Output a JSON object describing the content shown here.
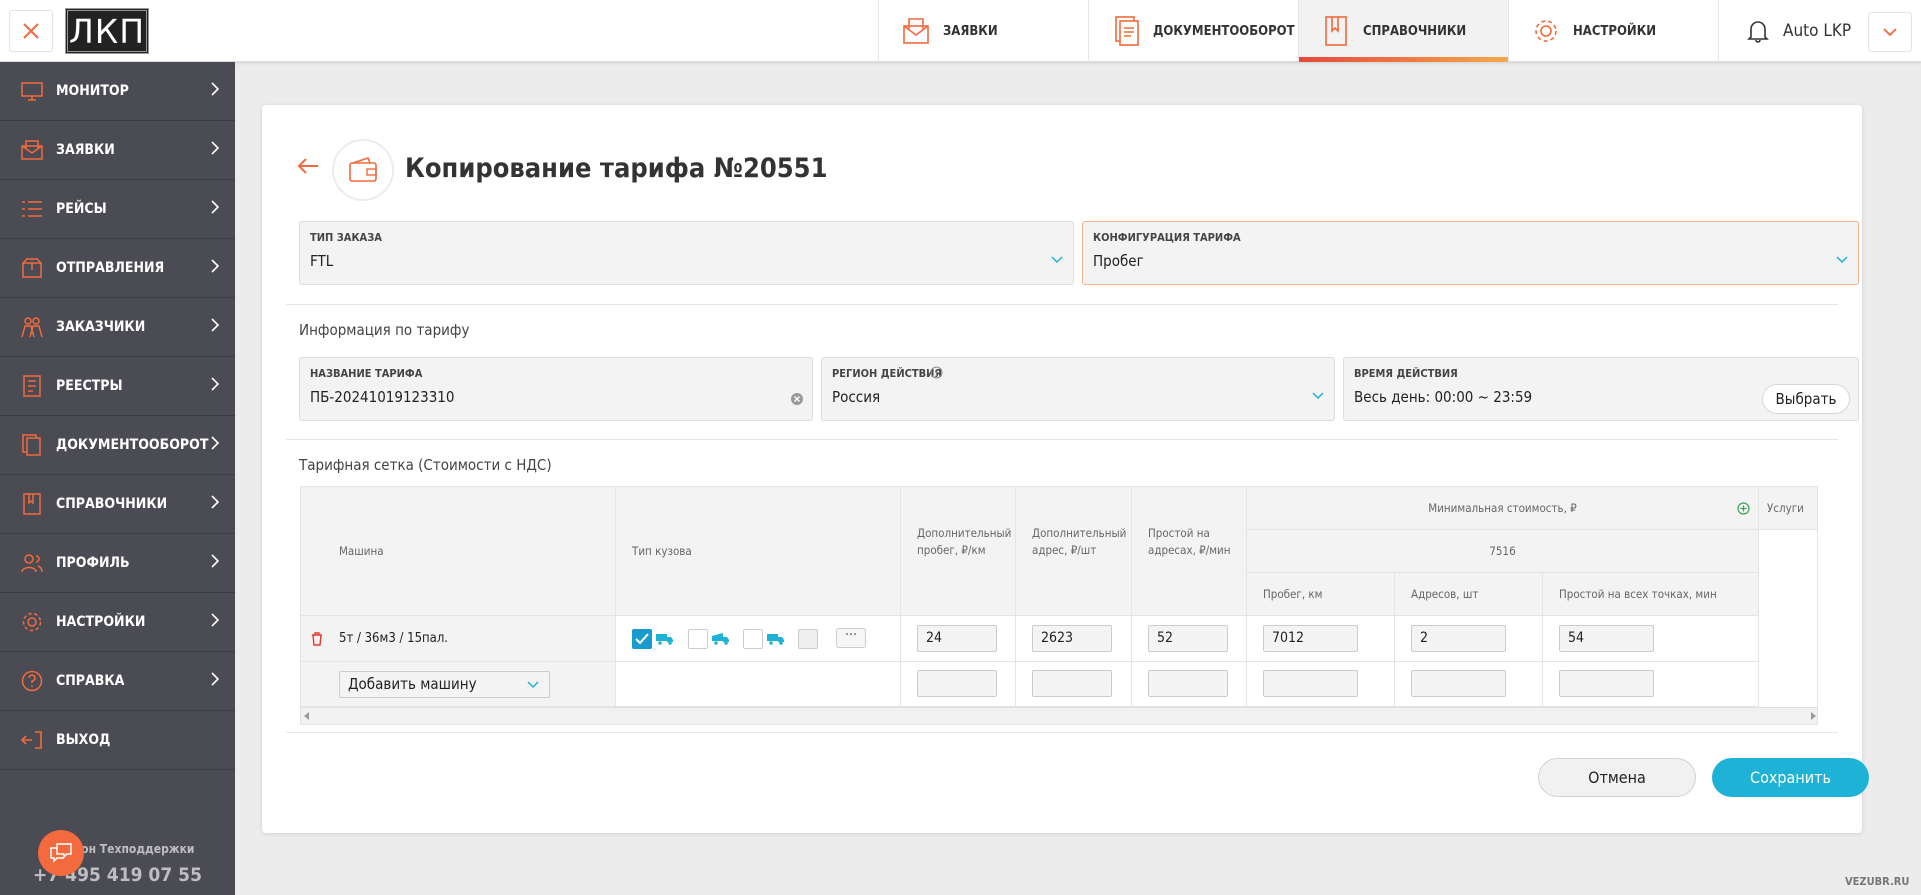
{
  "header": {
    "logo": "ЛКП",
    "tabs": [
      {
        "label": "ЗАЯВКИ",
        "icon": "envelope-icon"
      },
      {
        "label": "ДОКУМЕНТООБОРОТ",
        "icon": "documents-icon"
      },
      {
        "label": "СПРАВОЧНИКИ",
        "icon": "bookmark-book-icon",
        "active": true
      },
      {
        "label": "НАСТРОЙКИ",
        "icon": "gear-icon"
      }
    ],
    "user": "Auto LKP"
  },
  "sidebar": {
    "items": [
      {
        "label": "МОНИТОР",
        "icon": "monitor-icon"
      },
      {
        "label": "ЗАЯВКИ",
        "icon": "envelope-icon"
      },
      {
        "label": "РЕЙСЫ",
        "icon": "list-icon"
      },
      {
        "label": "ОТПРАВЛЕНИЯ",
        "icon": "box-icon"
      },
      {
        "label": "ЗАКАЗЧИКИ",
        "icon": "customers-icon"
      },
      {
        "label": "РЕЕСТРЫ",
        "icon": "registry-icon"
      },
      {
        "label": "ДОКУМЕНТООБОРОТ",
        "icon": "documents-icon"
      },
      {
        "label": "СПРАВОЧНИКИ",
        "icon": "book-icon"
      },
      {
        "label": "ПРОФИЛЬ",
        "icon": "profile-icon"
      },
      {
        "label": "НАСТРОЙКИ",
        "icon": "gear-icon"
      },
      {
        "label": "СПРАВКА",
        "icon": "help-icon"
      },
      {
        "label": "ВЫХОД",
        "icon": "logout-icon"
      }
    ],
    "support_label": "Телефон Техподдержки",
    "support_phone": "+7 495 419 07 55"
  },
  "page": {
    "title": "Копирование тарифа №20551",
    "order_type": {
      "label": "ТИП ЗАКАЗА",
      "value": "FTL"
    },
    "tariff_config": {
      "label": "КОНФИГУРАЦИЯ ТАРИФА",
      "value": "Пробег"
    },
    "info_section": "Информация по тарифу",
    "tariff_name": {
      "label": "НАЗВАНИЕ ТАРИФА",
      "value": "ПБ-20241019123310"
    },
    "region": {
      "label": "РЕГИОН ДЕЙСТВИЯ",
      "value": "Россия"
    },
    "time": {
      "label": "ВРЕМЯ ДЕЙСТВИЯ",
      "value": "Весь день: 00:00 ~ 23:59",
      "button": "Выбрать"
    },
    "grid_section": "Тарифная сетка (Стоимости с НДС)"
  },
  "grid": {
    "headers": {
      "car": "Машина",
      "body": "Тип кузова",
      "extra_km": "Дополнительный пробег, ₽/км",
      "extra_addr": "Дополнительный адрес, ₽/шт",
      "idle": "Простой на адресах, ₽/мин",
      "min_cost": "Минимальная стоимость, ₽",
      "min_cost_value": "7516",
      "services": "Услуги",
      "mileage": "Пробег, км",
      "addresses": "Адресов, шт",
      "idle_all": "Простой на всех точках, мин"
    },
    "row": {
      "car": "5т / 36м3 / 15пал.",
      "extra_km": "24",
      "extra_addr": "2623",
      "idle": "52",
      "mileage": "7012",
      "addresses": "2",
      "idle_all": "54"
    },
    "add_car": "Добавить машину"
  },
  "actions": {
    "cancel": "Отмена",
    "save": "Сохранить"
  },
  "watermark": "VEZUBR.RU",
  "colors": {
    "accent": "#f26a3d",
    "primary": "#1fb2d7",
    "sidebar": "#4b4b53"
  }
}
